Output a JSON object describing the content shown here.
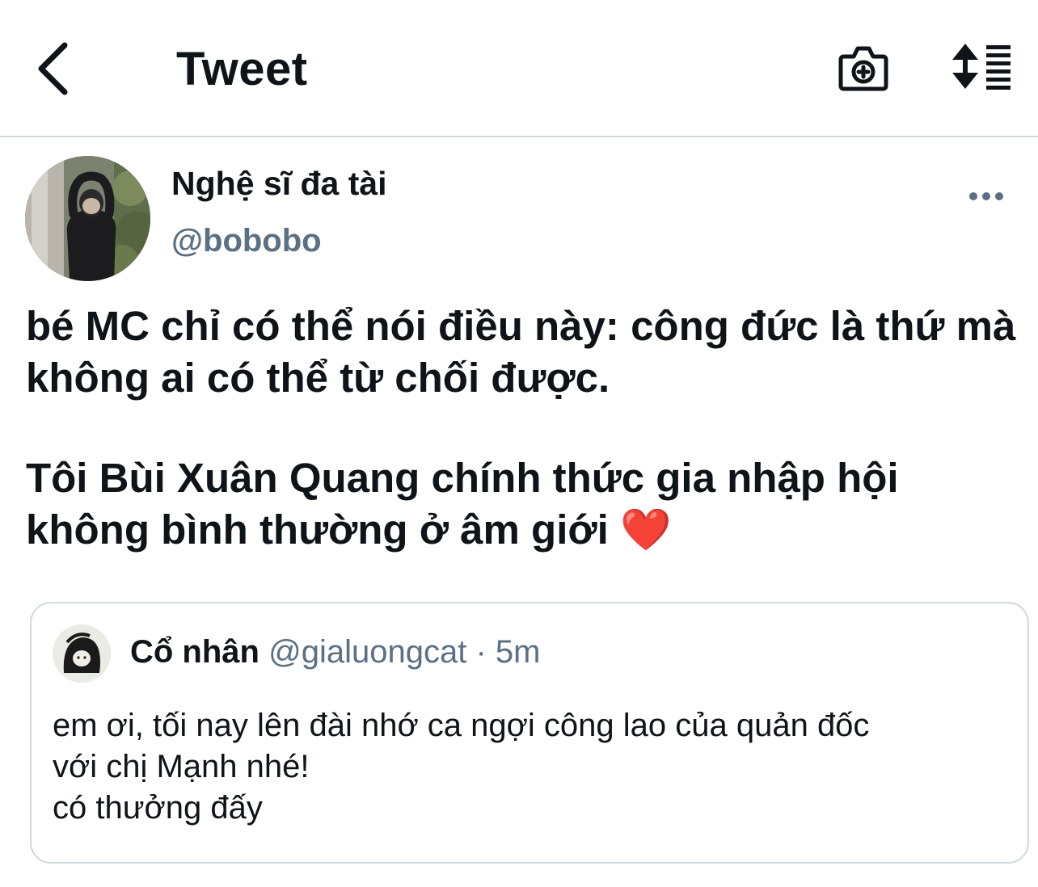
{
  "header": {
    "title": "Tweet",
    "back_icon": "chevron-left-icon",
    "camera_icon": "camera-plus-icon",
    "sort_icon": "sort-list-icon"
  },
  "tweet": {
    "author_name": "Nghệ sĩ đa tài",
    "author_handle": "@bobobo",
    "more_icon": "more-horizontal-icon",
    "paragraphs": [
      "bé MC chỉ có thể nói điều này: công đức là thứ mà không ai có thể từ chối được.",
      "Tôi Bùi Xuân Quang chính thức gia nhập hội không bình thường ở âm giới"
    ],
    "emoji": "❤️"
  },
  "quote": {
    "name": "Cổ nhân",
    "handle": "@gialuongcat",
    "separator": "·",
    "time": "5m",
    "lines": [
      "em ơi, tối nay lên đài nhớ ca ngợi công lao của quản đốc",
      "với chị Mạnh nhé!",
      "có thưởng đấy"
    ]
  },
  "colors": {
    "text": "#0f1419",
    "secondary": "#5b7083",
    "border": "#cfd9de",
    "heart": "#e0245e"
  }
}
